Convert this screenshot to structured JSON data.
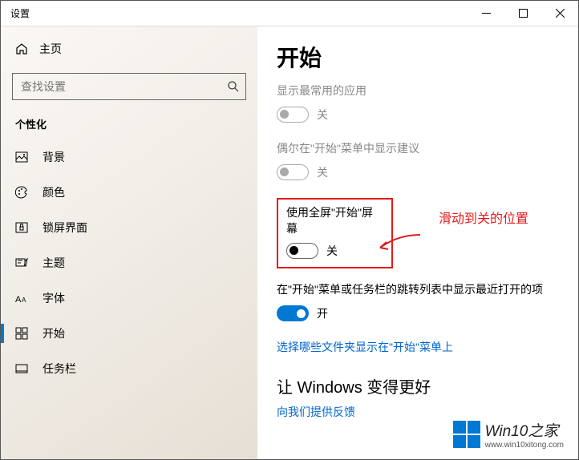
{
  "titlebar": {
    "title": "设置"
  },
  "sidebar": {
    "home": "主页",
    "search_placeholder": "查找设置",
    "section": "个性化",
    "items": [
      {
        "label": "背景"
      },
      {
        "label": "颜色"
      },
      {
        "label": "锁屏界面"
      },
      {
        "label": "主题"
      },
      {
        "label": "字体"
      },
      {
        "label": "开始"
      },
      {
        "label": "任务栏"
      }
    ]
  },
  "main": {
    "heading": "开始",
    "settings": [
      {
        "label": "显示最常用的应用",
        "state": "关",
        "disabled": true
      },
      {
        "label": "偶尔在\"开始\"菜单中显示建议",
        "state": "关",
        "disabled": true
      },
      {
        "label": "使用全屏\"开始\"屏幕",
        "state": "关",
        "disabled": false
      },
      {
        "label": "在\"开始\"菜单或任务栏的跳转列表中显示最近打开的项",
        "state": "开",
        "disabled": false
      }
    ],
    "link1": "选择哪些文件夹显示在\"开始\"菜单上",
    "sub_heading": "让 Windows 变得更好",
    "link2": "向我们提供反馈"
  },
  "annotation": "滑动到关的位置",
  "watermark": {
    "brand": "Win10之家",
    "url": "www.win10xitong.com"
  }
}
